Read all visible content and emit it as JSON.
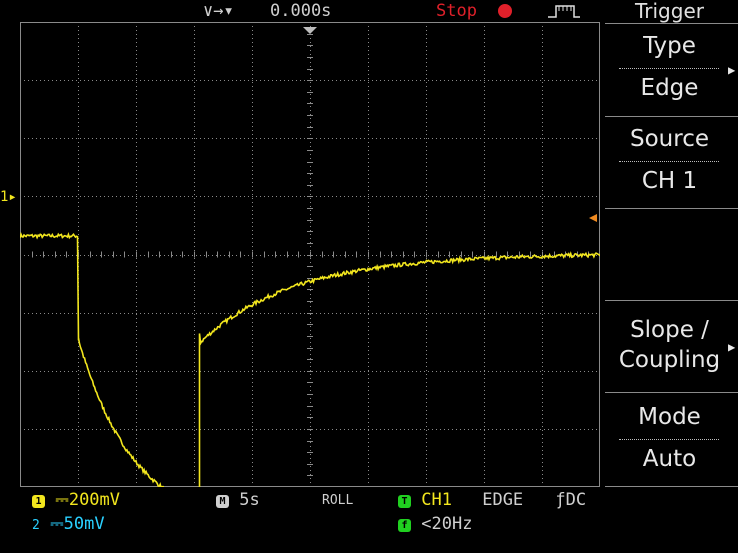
{
  "colors": {
    "ch1": "#f2e61e",
    "ch2": "#2ad0ff",
    "grid": "#8a8a8a",
    "stop": "#e0202a",
    "trigger_green": "#20d020",
    "menu_text": "#e8e8e8",
    "background": "#000000"
  },
  "top": {
    "trigger_arrows": "∨→▾",
    "time_offset": "0.000s",
    "run_status": "Stop",
    "trigger_icon": "edge-trigger-icon"
  },
  "ch1_marker": "1▸",
  "menu": {
    "title": "Trigger",
    "items": [
      {
        "label": "Type",
        "value": "Edge"
      },
      {
        "label": "Source",
        "value": "CH 1"
      },
      {
        "label": "",
        "value": ""
      },
      {
        "label": "Slope /",
        "value": "Coupling"
      },
      {
        "label": "Mode",
        "value": "Auto"
      }
    ]
  },
  "bottom": {
    "ch1_num": "1",
    "ch1_coupling": "⎓",
    "ch1_scale": "200mV",
    "ch2_num": "2",
    "ch2_coupling": "⎓",
    "ch2_scale": "50mV",
    "timebase_badge": "M",
    "timebase": "5s",
    "mode": "ROLL",
    "trig_badge": "T",
    "trig_source": "CH1",
    "trig_type": "EDGE",
    "trig_slope": "ƒ",
    "trig_coupling": "DC",
    "freq_badge": "f",
    "frequency": "<20Hz"
  },
  "waveform": {
    "name": "ch1-trace",
    "baseline_level": 0.54,
    "drop_end_level": 0.32,
    "min_level": -0.045,
    "final_level": 0.51,
    "step_down_time": 0.1,
    "recovery_time": 0.31
  }
}
